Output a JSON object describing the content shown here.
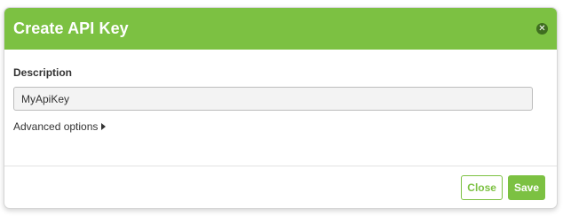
{
  "dialog": {
    "title": "Create API Key",
    "close_icon": "close-circle-icon"
  },
  "form": {
    "description_label": "Description",
    "description_value": "MyApiKey",
    "advanced_label": "Advanced options",
    "advanced_icon": "caret-right-icon"
  },
  "footer": {
    "close_label": "Close",
    "save_label": "Save"
  },
  "colors": {
    "accent": "#7cc142",
    "close_icon_bg": "#3f6e20"
  }
}
